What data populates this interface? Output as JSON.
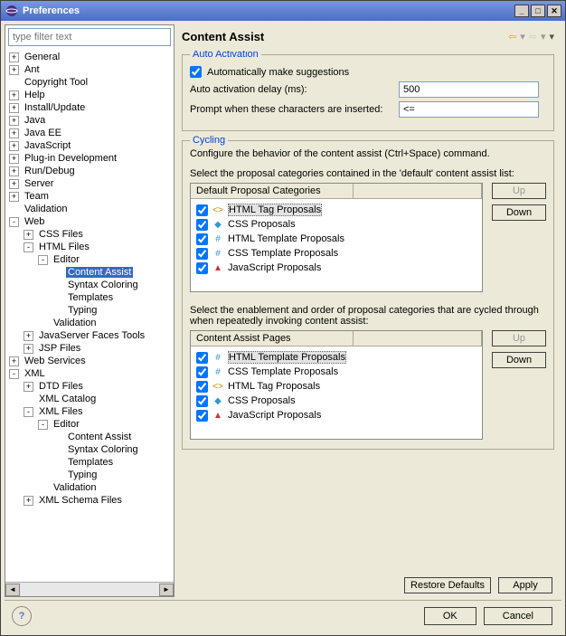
{
  "window": {
    "title": "Preferences"
  },
  "filter": {
    "placeholder": "type filter text"
  },
  "tree": [
    {
      "l": 1,
      "e": "+",
      "t": "General"
    },
    {
      "l": 1,
      "e": "+",
      "t": "Ant"
    },
    {
      "l": 1,
      "e": "",
      "t": "Copyright Tool"
    },
    {
      "l": 1,
      "e": "+",
      "t": "Help"
    },
    {
      "l": 1,
      "e": "+",
      "t": "Install/Update"
    },
    {
      "l": 1,
      "e": "+",
      "t": "Java"
    },
    {
      "l": 1,
      "e": "+",
      "t": "Java EE"
    },
    {
      "l": 1,
      "e": "+",
      "t": "JavaScript"
    },
    {
      "l": 1,
      "e": "+",
      "t": "Plug-in Development"
    },
    {
      "l": 1,
      "e": "+",
      "t": "Run/Debug"
    },
    {
      "l": 1,
      "e": "+",
      "t": "Server"
    },
    {
      "l": 1,
      "e": "+",
      "t": "Team"
    },
    {
      "l": 1,
      "e": "",
      "t": "Validation"
    },
    {
      "l": 1,
      "e": "-",
      "t": "Web"
    },
    {
      "l": 2,
      "e": "+",
      "t": "CSS Files"
    },
    {
      "l": 2,
      "e": "-",
      "t": "HTML Files"
    },
    {
      "l": 3,
      "e": "-",
      "t": "Editor"
    },
    {
      "l": 4,
      "e": "",
      "t": "Content Assist",
      "sel": true
    },
    {
      "l": 4,
      "e": "",
      "t": "Syntax Coloring"
    },
    {
      "l": 4,
      "e": "",
      "t": "Templates"
    },
    {
      "l": 4,
      "e": "",
      "t": "Typing"
    },
    {
      "l": 3,
      "e": "",
      "t": "Validation"
    },
    {
      "l": 2,
      "e": "+",
      "t": "JavaServer Faces Tools"
    },
    {
      "l": 2,
      "e": "+",
      "t": "JSP Files"
    },
    {
      "l": 1,
      "e": "+",
      "t": "Web Services"
    },
    {
      "l": 1,
      "e": "-",
      "t": "XML"
    },
    {
      "l": 2,
      "e": "+",
      "t": "DTD Files"
    },
    {
      "l": 2,
      "e": "",
      "t": "XML Catalog"
    },
    {
      "l": 2,
      "e": "-",
      "t": "XML Files"
    },
    {
      "l": 3,
      "e": "-",
      "t": "Editor"
    },
    {
      "l": 4,
      "e": "",
      "t": "Content Assist"
    },
    {
      "l": 4,
      "e": "",
      "t": "Syntax Coloring"
    },
    {
      "l": 4,
      "e": "",
      "t": "Templates"
    },
    {
      "l": 4,
      "e": "",
      "t": "Typing"
    },
    {
      "l": 3,
      "e": "",
      "t": "Validation"
    },
    {
      "l": 2,
      "e": "+",
      "t": "XML Schema Files"
    }
  ],
  "page": {
    "title": "Content Assist",
    "auto": {
      "group_title": "Auto Activation",
      "auto_suggest_label": "Automatically make suggestions",
      "auto_suggest_checked": true,
      "delay_label": "Auto activation delay (ms):",
      "delay_value": "500",
      "prompt_label": "Prompt when these characters are inserted:",
      "prompt_value": "<="
    },
    "cycling": {
      "group_title": "Cycling",
      "intro": "Configure the behavior of the content assist (Ctrl+Space) command.",
      "defaults_label": "Select the proposal categories contained in the 'default' content assist list:",
      "defaults_header": "Default Proposal Categories",
      "defaults": [
        {
          "c": true,
          "icon": "<>",
          "t": "HTML Tag Proposals",
          "sel": true,
          "color": "#c80"
        },
        {
          "c": true,
          "icon": "◆",
          "t": "CSS Proposals",
          "color": "#39c"
        },
        {
          "c": true,
          "icon": "#",
          "t": "HTML Template Proposals",
          "color": "#39c"
        },
        {
          "c": true,
          "icon": "#",
          "t": "CSS Template Proposals",
          "color": "#39c"
        },
        {
          "c": true,
          "icon": "▲",
          "t": "JavaScript Proposals",
          "color": "#c33"
        }
      ],
      "pages_label": "Select the enablement and order of proposal categories that are cycled through when repeatedly invoking content assist:",
      "pages_header": "Content Assist Pages",
      "pages": [
        {
          "c": true,
          "icon": "#",
          "t": "HTML Template Proposals",
          "sel": true,
          "color": "#39c"
        },
        {
          "c": true,
          "icon": "#",
          "t": "CSS Template Proposals",
          "color": "#39c"
        },
        {
          "c": true,
          "icon": "<>",
          "t": "HTML Tag Proposals",
          "color": "#c80"
        },
        {
          "c": true,
          "icon": "◆",
          "t": "CSS Proposals",
          "color": "#39c"
        },
        {
          "c": true,
          "icon": "▲",
          "t": "JavaScript Proposals",
          "color": "#c33"
        }
      ],
      "up": "Up",
      "down": "Down"
    },
    "restore": "Restore Defaults",
    "apply": "Apply"
  },
  "buttons": {
    "ok": "OK",
    "cancel": "Cancel"
  }
}
